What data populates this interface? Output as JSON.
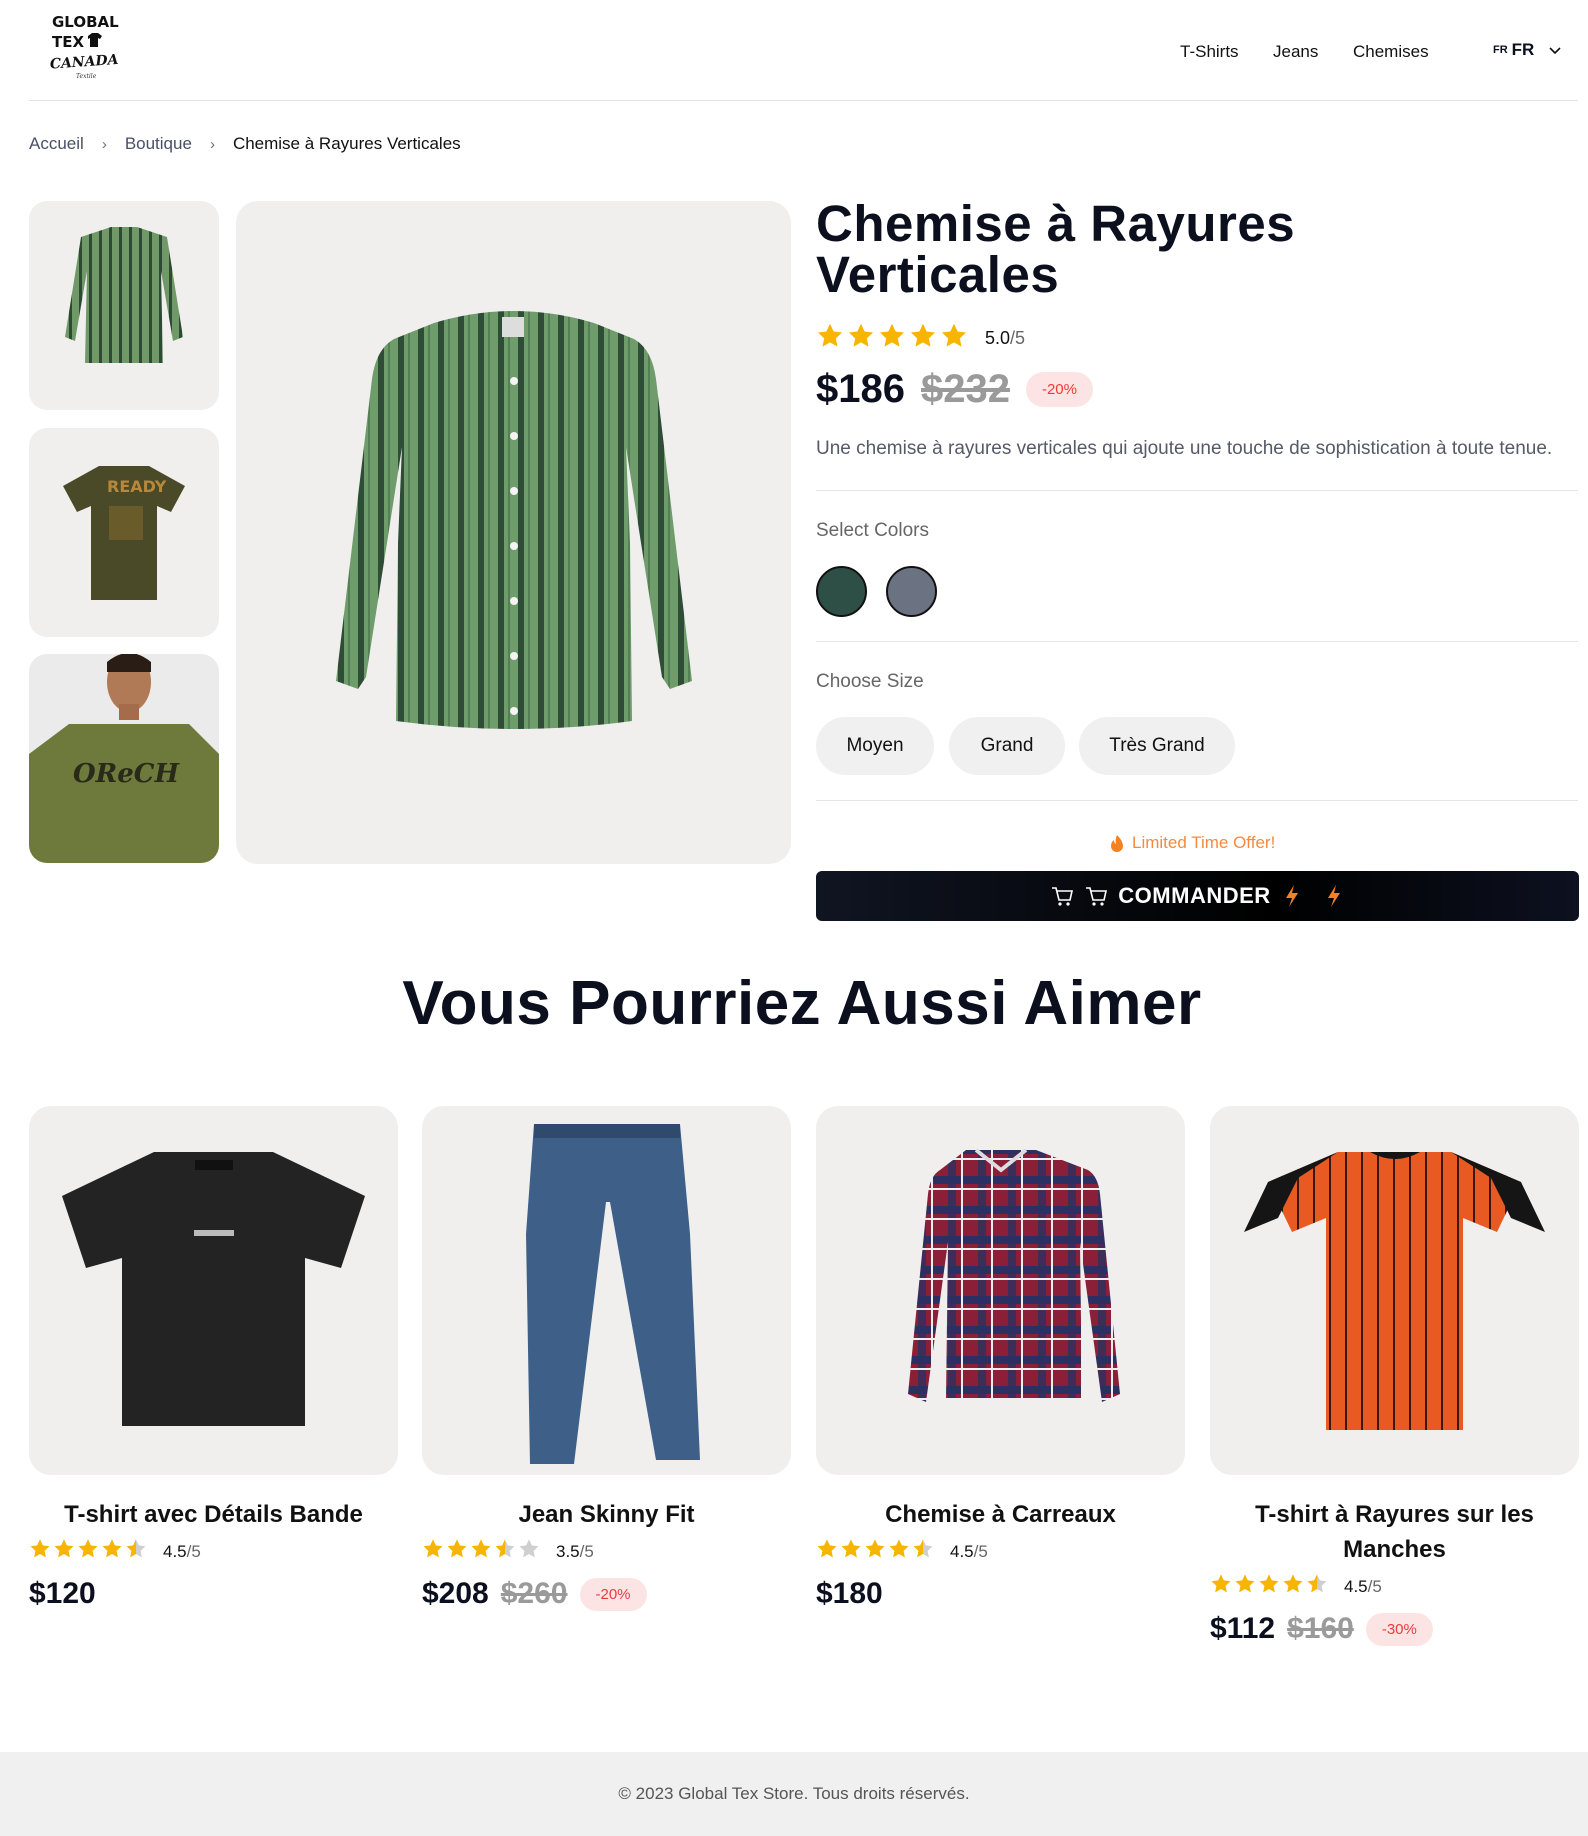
{
  "header": {
    "logo": {
      "line1": "GLOBAL",
      "line2": "TEX",
      "line3": "CANADA",
      "script": "Textile"
    },
    "nav": [
      "T-Shirts",
      "Jeans",
      "Chemises"
    ],
    "language": {
      "small": "FR",
      "code": "FR"
    }
  },
  "breadcrumb": [
    "Accueil",
    "Boutique",
    "Chemise à Rayures Verticales"
  ],
  "product": {
    "title_line1": "Chemise à Rayures",
    "title_line2": "Verticales",
    "rating": 5.0,
    "rating_text": "5.0",
    "rating_max": "/5",
    "price": "$186",
    "old_price": "$232",
    "discount": "-20%",
    "description": "Une chemise à rayures verticales qui ajoute une touche de sophistication à toute tenue.",
    "colors_label": "Select Colors",
    "colors": [
      "#2d4f45",
      "#6b7383"
    ],
    "size_label": "Choose Size",
    "sizes": [
      "Moyen",
      "Grand",
      "Très Grand"
    ],
    "offer": "Limited Time Offer!",
    "order_button": "COMMANDER"
  },
  "related": {
    "title": "Vous Pourriez Aussi Aimer",
    "items": [
      {
        "name": "T-shirt avec Détails Bande",
        "rating": 4.5,
        "rating_text": "4.5",
        "rating_max": "/5",
        "price": "$120",
        "old_price": "",
        "discount": ""
      },
      {
        "name": "Jean Skinny Fit",
        "rating": 3.5,
        "rating_text": "3.5",
        "rating_max": "/5",
        "price": "$208",
        "old_price": "$260",
        "discount": "-20%"
      },
      {
        "name": "Chemise à Carreaux",
        "rating": 4.5,
        "rating_text": "4.5",
        "rating_max": "/5",
        "price": "$180",
        "old_price": "",
        "discount": ""
      },
      {
        "name": "T-shirt à Rayures sur les Manches",
        "rating": 4.5,
        "rating_text": "4.5",
        "rating_max": "/5",
        "price": "$112",
        "old_price": "$160",
        "discount": "-30%"
      }
    ]
  },
  "footer": {
    "text": "© 2023 Global Tex Store. Tous droits réservés."
  },
  "colors": {
    "star": "#f7b500",
    "star_empty": "#cfcfcf",
    "badge_bg": "#fde4e4",
    "badge_text": "#ef3a3a",
    "offer": "#f58a3c",
    "bolt": "#f7811f"
  }
}
